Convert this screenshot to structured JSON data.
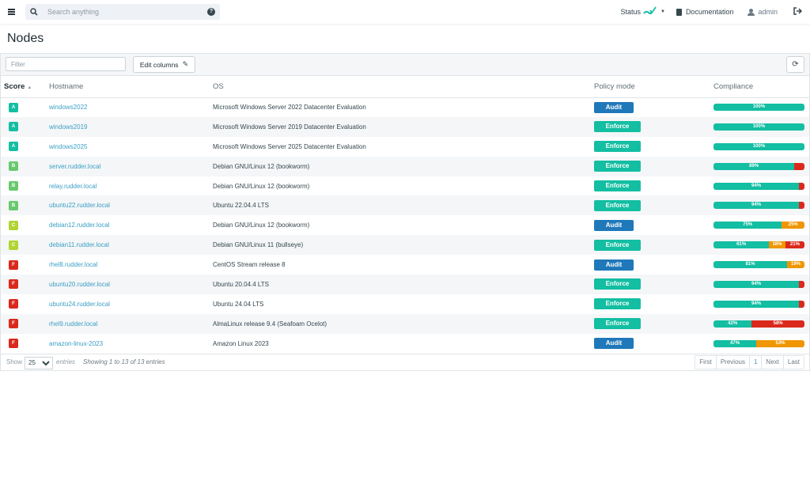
{
  "topbar": {
    "search_placeholder": "Search anything",
    "status_label": "Status",
    "documentation_label": "Documentation",
    "user_label": "admin"
  },
  "page": {
    "title": "Nodes"
  },
  "toolbar": {
    "filter_placeholder": "Filter",
    "edit_columns_label": "Edit columns"
  },
  "table": {
    "columns": [
      "Score",
      "Hostname",
      "OS",
      "Policy mode",
      "Compliance"
    ],
    "rows": [
      {
        "score": "A",
        "score_color": "#13bea2",
        "hostname": "windows2022",
        "os": "Microsoft Windows Server 2022 Datacenter Evaluation",
        "mode": "Audit",
        "compliance": [
          {
            "value": 100,
            "label": "100%",
            "color": "#13bea2"
          }
        ]
      },
      {
        "score": "A",
        "score_color": "#13bea2",
        "hostname": "windows2019",
        "os": "Microsoft Windows Server 2019 Datacenter Evaluation",
        "mode": "Enforce",
        "compliance": [
          {
            "value": 100,
            "label": "100%",
            "color": "#13bea2"
          }
        ]
      },
      {
        "score": "A",
        "score_color": "#13bea2",
        "hostname": "windows2025",
        "os": "Microsoft Windows Server 2025 Datacenter Evaluation",
        "mode": "Enforce",
        "compliance": [
          {
            "value": 100,
            "label": "100%",
            "color": "#13bea2"
          }
        ]
      },
      {
        "score": "B",
        "score_color": "#68c96d",
        "hostname": "server.rudder.local",
        "os": "Debian GNU/Linux 12 (bookworm)",
        "mode": "Enforce",
        "compliance": [
          {
            "value": 89,
            "label": "89%",
            "color": "#13bea2"
          },
          {
            "value": 11,
            "label": "",
            "color": "#da291c"
          }
        ]
      },
      {
        "score": "B",
        "score_color": "#68c96d",
        "hostname": "relay.rudder.local",
        "os": "Debian GNU/Linux 12 (bookworm)",
        "mode": "Enforce",
        "compliance": [
          {
            "value": 94,
            "label": "94%",
            "color": "#13bea2"
          },
          {
            "value": 6,
            "label": "",
            "color": "#da291c"
          }
        ]
      },
      {
        "score": "B",
        "score_color": "#68c96d",
        "hostname": "ubuntu22.rudder.local",
        "os": "Ubuntu 22.04.4 LTS",
        "mode": "Enforce",
        "compliance": [
          {
            "value": 94,
            "label": "94%",
            "color": "#13bea2"
          },
          {
            "value": 6,
            "label": "",
            "color": "#da291c"
          }
        ]
      },
      {
        "score": "C",
        "score_color": "#b1d432",
        "hostname": "debian12.rudder.local",
        "os": "Debian GNU/Linux 12 (bookworm)",
        "mode": "Audit",
        "compliance": [
          {
            "value": 75,
            "label": "75%",
            "color": "#13bea2"
          },
          {
            "value": 25,
            "label": "25%",
            "color": "#ef9600"
          }
        ]
      },
      {
        "score": "C",
        "score_color": "#b1d432",
        "hostname": "debian11.rudder.local",
        "os": "Debian GNU/Linux 11 (bullseye)",
        "mode": "Enforce",
        "compliance": [
          {
            "value": 61,
            "label": "61%",
            "color": "#13bea2"
          },
          {
            "value": 18,
            "label": "18%",
            "color": "#ef9600"
          },
          {
            "value": 21,
            "label": "21%",
            "color": "#da291c"
          }
        ]
      },
      {
        "score": "F",
        "score_color": "#da291c",
        "hostname": "rhel8.rudder.local",
        "os": "CentOS Stream release 8",
        "mode": "Audit",
        "compliance": [
          {
            "value": 81,
            "label": "81%",
            "color": "#13bea2"
          },
          {
            "value": 19,
            "label": "19%",
            "color": "#ef9600"
          }
        ]
      },
      {
        "score": "F",
        "score_color": "#da291c",
        "hostname": "ubuntu20.rudder.local",
        "os": "Ubuntu 20.04.4 LTS",
        "mode": "Enforce",
        "compliance": [
          {
            "value": 94,
            "label": "94%",
            "color": "#13bea2"
          },
          {
            "value": 6,
            "label": "",
            "color": "#da291c"
          }
        ]
      },
      {
        "score": "F",
        "score_color": "#da291c",
        "hostname": "ubuntu24.rudder.local",
        "os": "Ubuntu 24.04 LTS",
        "mode": "Enforce",
        "compliance": [
          {
            "value": 94,
            "label": "94%",
            "color": "#13bea2"
          },
          {
            "value": 6,
            "label": "",
            "color": "#da291c"
          }
        ]
      },
      {
        "score": "F",
        "score_color": "#da291c",
        "hostname": "rhel9.rudder.local",
        "os": "AlmaLinux release 9.4 (Seafoam Ocelot)",
        "mode": "Enforce",
        "compliance": [
          {
            "value": 42,
            "label": "42%",
            "color": "#13bea2"
          },
          {
            "value": 58,
            "label": "58%",
            "color": "#da291c"
          }
        ]
      },
      {
        "score": "F",
        "score_color": "#da291c",
        "hostname": "amazon-linux-2023",
        "os": "Amazon Linux 2023",
        "mode": "Audit",
        "compliance": [
          {
            "value": 47,
            "label": "47%",
            "color": "#13bea2"
          },
          {
            "value": 53,
            "label": "53%",
            "color": "#ef9600"
          }
        ]
      }
    ]
  },
  "footer": {
    "show_label": "Show",
    "page_size": "25",
    "entries_label": "entries",
    "info": "Showing 1 to 13 of 13 entries",
    "pager": [
      "First",
      "Previous",
      "1",
      "Next",
      "Last"
    ]
  }
}
